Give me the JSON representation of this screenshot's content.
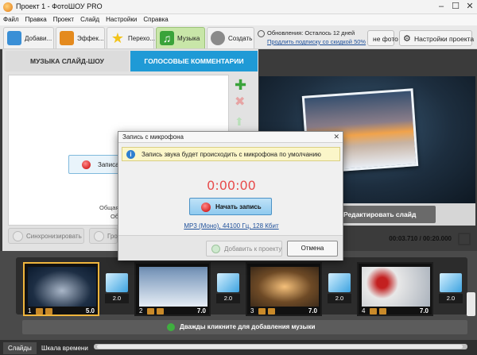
{
  "window": {
    "title": "Проект 1 - ФотоШОУ PRO",
    "minimize": "–",
    "maximize": "☐",
    "close": "✕"
  },
  "menu": [
    "Файл",
    "Правка",
    "Проект",
    "Слайд",
    "Настройки",
    "Справка"
  ],
  "tabs": [
    {
      "label": "Добави...",
      "icon": "add-photos-icon",
      "color": "#3a8fd6"
    },
    {
      "label": "Эффек...",
      "icon": "palette-icon",
      "color": "#e48a1e"
    },
    {
      "label": "Перехо...",
      "icon": "star-icon",
      "color": "#f2c31a"
    },
    {
      "label": "Музыка",
      "icon": "music-note-icon",
      "color": "#3aa33a"
    },
    {
      "label": "Создать",
      "icon": "film-reel-icon",
      "color": "#6e6e6e"
    }
  ],
  "updates": {
    "line1": "Обновления: Осталось 12 дней",
    "line2": "Продлить подписку со скидкой 50%"
  },
  "toolbar": {
    "photo_btn": "не фото",
    "settings_btn": "Настройки проекта"
  },
  "music_panel": {
    "tab_music": "МУЗЫКА СЛАЙД-ШОУ",
    "tab_voice": "ГОЛОСОВЫЕ КОММЕНТАРИИ",
    "record_btn": "Записать",
    "partial1": "Общая",
    "partial2": "Об",
    "sync_btn": "Синхронизировать",
    "partial_btn": "Гро"
  },
  "preview": {
    "edit_btn": "Редактировать слайд",
    "time": "00:03.710 / 00:20.000"
  },
  "dialog": {
    "title": "Запись с микрофона",
    "info": "Запись звука будет происходить с микрофона по умолчанию",
    "timer": "0:00:00",
    "start_btn": "Начать запись",
    "format_link": "MP3 (Моно), 44100 Гц, 128 Кбит",
    "add_btn": "Добавить к проекту",
    "cancel_btn": "Отмена"
  },
  "slides": [
    {
      "num": "1",
      "dur": "5.0",
      "colors": [
        "#0b1a2e",
        "#a9b6c8"
      ]
    },
    {
      "num": "2",
      "dur": "7.0",
      "colors": [
        "#6f8fb5",
        "#e6edf5"
      ]
    },
    {
      "num": "3",
      "dur": "7.0",
      "colors": [
        "#3d2b1a",
        "#f5c07a"
      ]
    },
    {
      "num": "4",
      "dur": "7.0",
      "colors": [
        "#7a1a1a",
        "#e8e8e8"
      ]
    }
  ],
  "transitions": [
    "2.0",
    "2.0",
    "2.0",
    "2.0",
    "2.0"
  ],
  "music_row": "Дважды кликните для добавления музыки",
  "status_tabs": [
    "Слайды",
    "Шкала времени"
  ]
}
